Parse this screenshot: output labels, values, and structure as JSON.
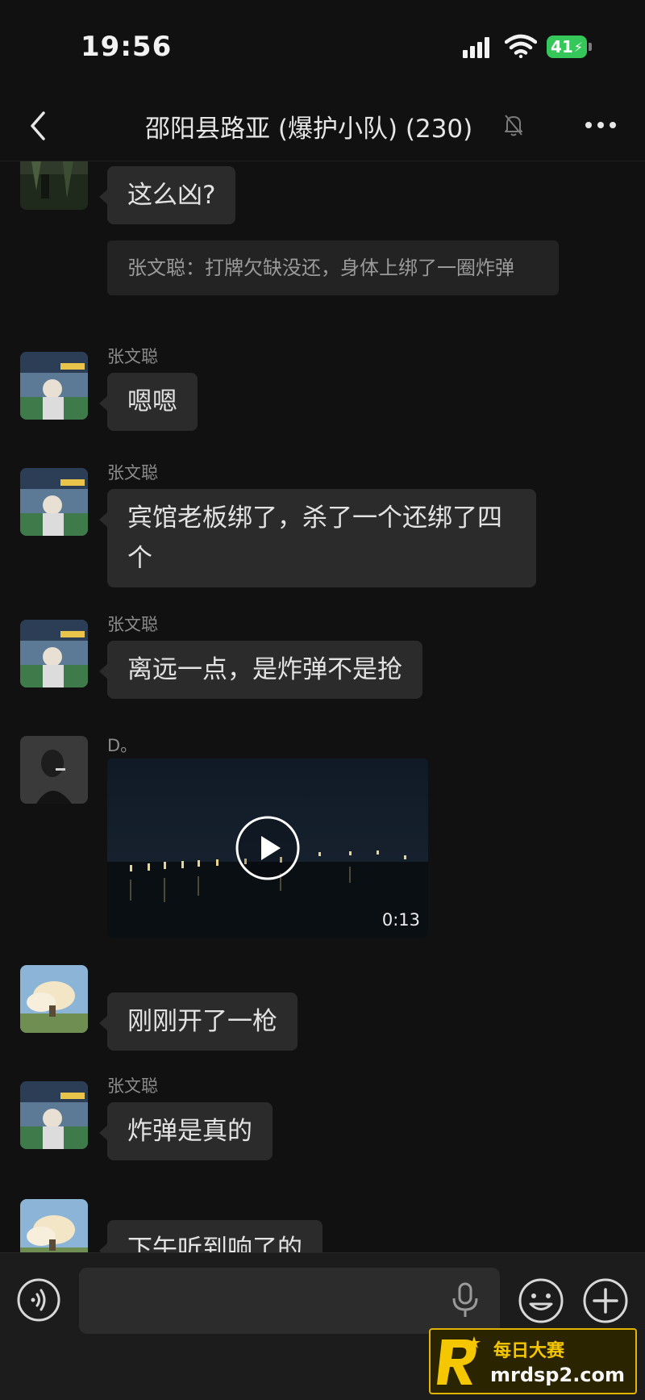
{
  "status_bar": {
    "time": "19:56",
    "battery": "41"
  },
  "nav": {
    "title": "邵阳县路亚 (爆护小队) (230)"
  },
  "messages": [
    {
      "type": "text",
      "sender": "",
      "text": "这么凶?",
      "quote": "张文聪：打牌欠缺没还，身体上绑了一圈炸弹"
    },
    {
      "type": "text",
      "sender": "张文聪",
      "text": "嗯嗯"
    },
    {
      "type": "text",
      "sender": "张文聪",
      "text": "宾馆老板绑了，杀了一个还绑了四个"
    },
    {
      "type": "text",
      "sender": "张文聪",
      "text": "离远一点，是炸弹不是抢"
    },
    {
      "type": "video",
      "sender": "D。",
      "duration": "0:13"
    },
    {
      "type": "text",
      "sender": "",
      "text": "刚刚开了一枪"
    },
    {
      "type": "text",
      "sender": "张文聪",
      "text": "炸弹是真的"
    },
    {
      "type": "text",
      "sender": "",
      "text": "下午听到响了的"
    }
  ],
  "input_bar": {
    "input_value": "",
    "placeholder": ""
  },
  "watermark": {
    "line1": "每日大赛",
    "line2": "mrdsp2.com"
  },
  "colors": {
    "background": "#111111",
    "bubble": "#2b2b2b",
    "input_bar": "#1c1c1c",
    "battery": "#35c759",
    "watermark_accent": "#f4c700"
  },
  "icons": [
    "back-icon",
    "mute-icon",
    "more-icon",
    "play-icon",
    "voice-icon",
    "mic-icon",
    "emoji-icon",
    "plus-icon"
  ]
}
